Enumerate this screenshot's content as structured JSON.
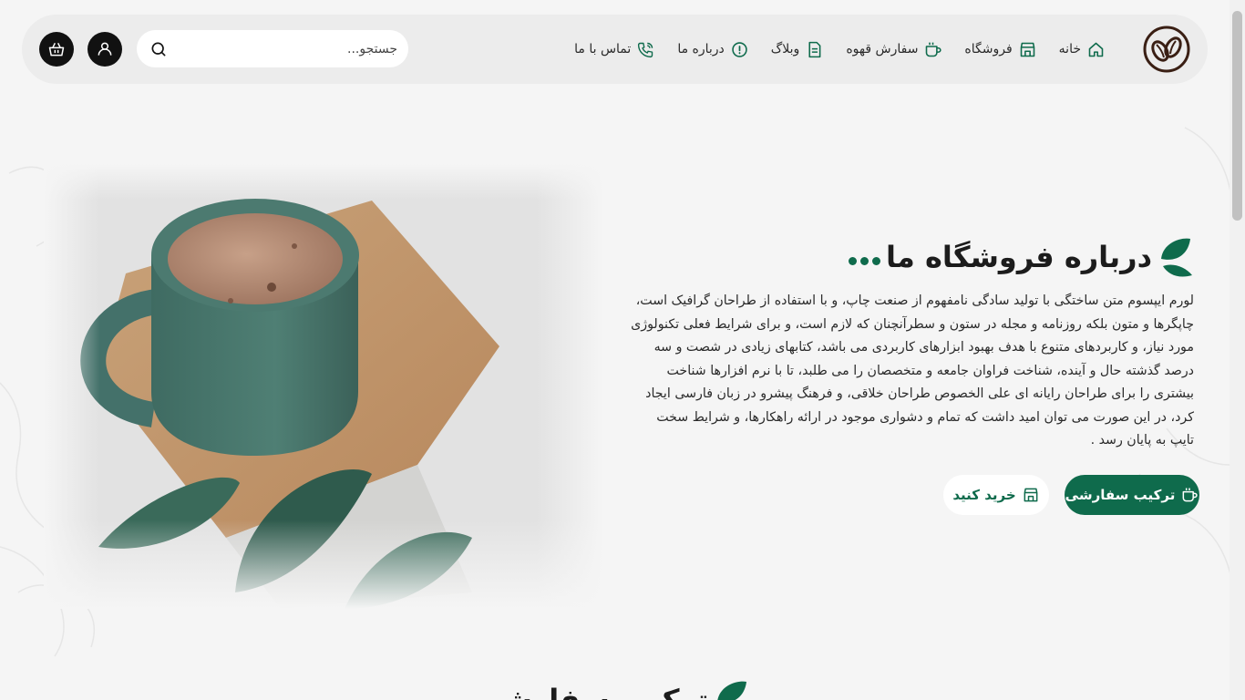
{
  "header": {
    "nav": [
      {
        "label": "خانه",
        "icon": "home-icon"
      },
      {
        "label": "فروشگاه",
        "icon": "store-icon"
      },
      {
        "label": "سفارش قهوه",
        "icon": "coffee-cup-icon"
      },
      {
        "label": "وبلاگ",
        "icon": "document-icon"
      },
      {
        "label": "درباره ما",
        "icon": "info-icon"
      },
      {
        "label": "تماس با ما",
        "icon": "phone-call-icon"
      }
    ],
    "search_placeholder": "جستجو..."
  },
  "about": {
    "title": "درباره فروشگاه ما",
    "text": "لورم ایپسوم متن ساختگی با تولید سادگی نامفهوم از صنعت چاپ، و با استفاده از طراحان گرافیک است، چاپگرها و متون بلکه روزنامه و مجله در ستون و سطرآنچنان که لازم است، و برای شرایط فعلی تکنولوژی مورد نیاز، و کاربردهای متنوع با هدف بهبود ابزارهای کاربردی می باشد، کتابهای زیادی در شصت و سه درصد گذشته حال و آینده، شناخت فراوان جامعه و متخصصان را می طلبد، تا با نرم افزارها شناخت بیشتری را برای طراحان رایانه ای علی الخصوص طراحان خلاقی، و فرهنگ پیشرو در زبان فارسی ایجاد کرد، در این صورت می توان امید داشت که تمام و دشواری موجود در ارائه راهکارها، و شرایط سخت تایپ به پایان رسد .",
    "primary_button": "ترکیب سفارشی",
    "secondary_button": "خرید کنید"
  },
  "section2": {
    "title": "ترکیب سفارشی"
  },
  "colors": {
    "brand_green": "#0f6b4c",
    "background": "#f5f5f5",
    "header_bg": "#ececec"
  }
}
